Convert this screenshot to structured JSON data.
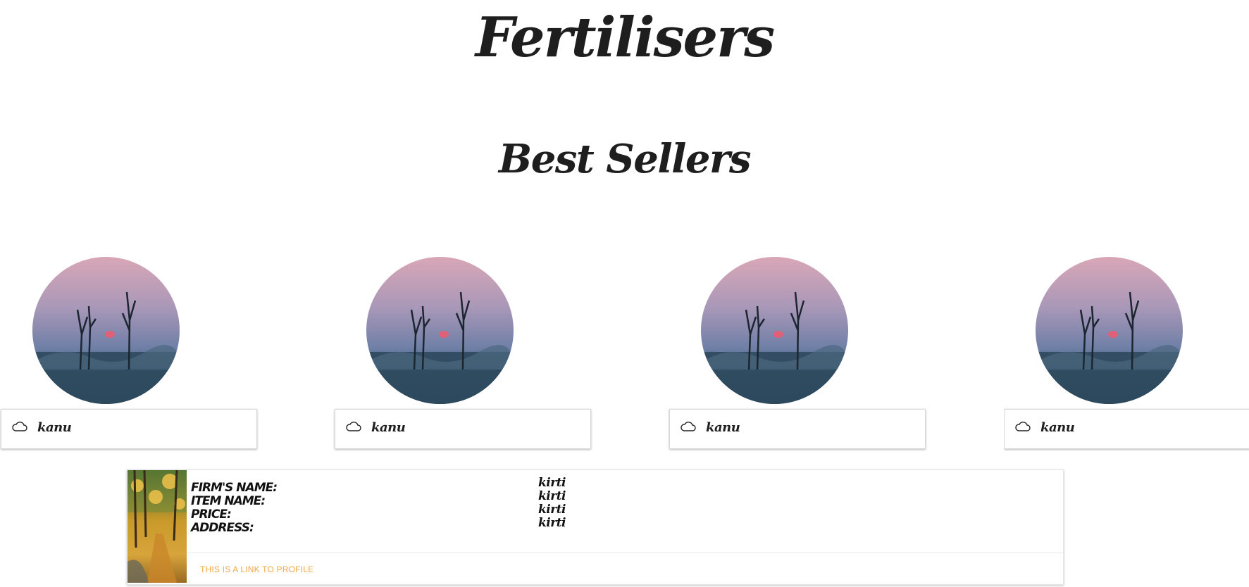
{
  "page": {
    "title": "Fertilisers"
  },
  "best_sellers": {
    "heading": "Best Sellers",
    "items": [
      {
        "name": "kanu",
        "icon": "cloud-icon",
        "image": "misty-sunset-trees"
      },
      {
        "name": "kanu",
        "icon": "cloud-icon",
        "image": "misty-sunset-trees"
      },
      {
        "name": "kanu",
        "icon": "cloud-icon",
        "image": "misty-sunset-trees"
      },
      {
        "name": "kanu",
        "icon": "cloud-icon",
        "image": "misty-sunset-trees"
      }
    ]
  },
  "profile_card": {
    "image": "autumn-forest-path",
    "labels": [
      "FIRM'S NAME:",
      "ITEM NAME:",
      "PRICE:",
      "ADDRESS:"
    ],
    "values": [
      "kirti",
      "kirti",
      "kirti",
      "kirti"
    ],
    "link_text": "THIS IS A LINK TO PROFILE"
  },
  "colors": {
    "link": "#f0a94a",
    "text": "#1e1e1e",
    "card_border": "#d8d8d8"
  }
}
